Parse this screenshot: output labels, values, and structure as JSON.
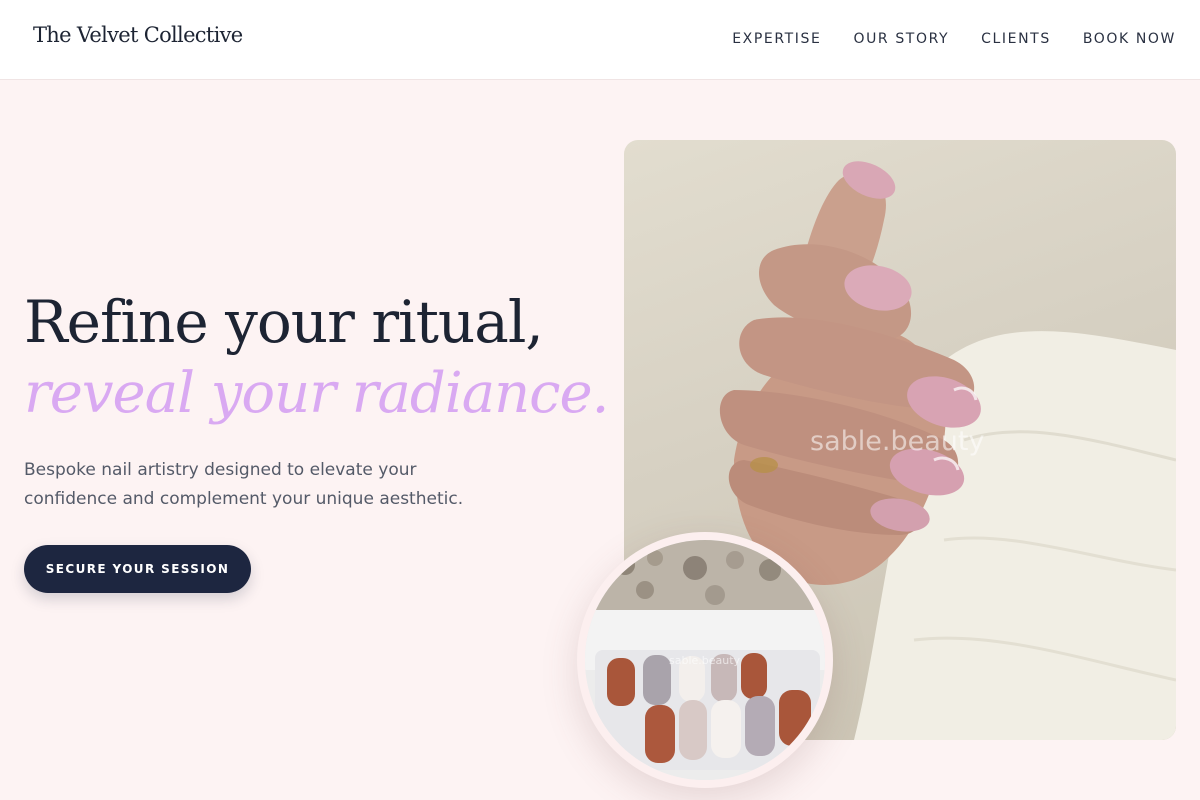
{
  "brand": {
    "name": "The Velvet Collective"
  },
  "nav": {
    "items": [
      {
        "label": "EXPERTISE"
      },
      {
        "label": "OUR STORY"
      },
      {
        "label": "CLIENTS"
      },
      {
        "label": "BOOK NOW"
      }
    ]
  },
  "hero": {
    "headline": "Refine your ritual,",
    "headline_accent": "reveal your radiance.",
    "subtext": "Bespoke nail artistry designed to elevate your confidence and complement your unique aesthetic.",
    "cta_label": "SECURE YOUR SESSION",
    "main_image_watermark": "sable.beauty",
    "inset_image_watermark": "sable.beauty"
  },
  "colors": {
    "page_background": "#fdf3f3",
    "text_dark": "#1d2433",
    "accent_lilac": "#d9a9f2",
    "button_navy": "#1d2640"
  }
}
